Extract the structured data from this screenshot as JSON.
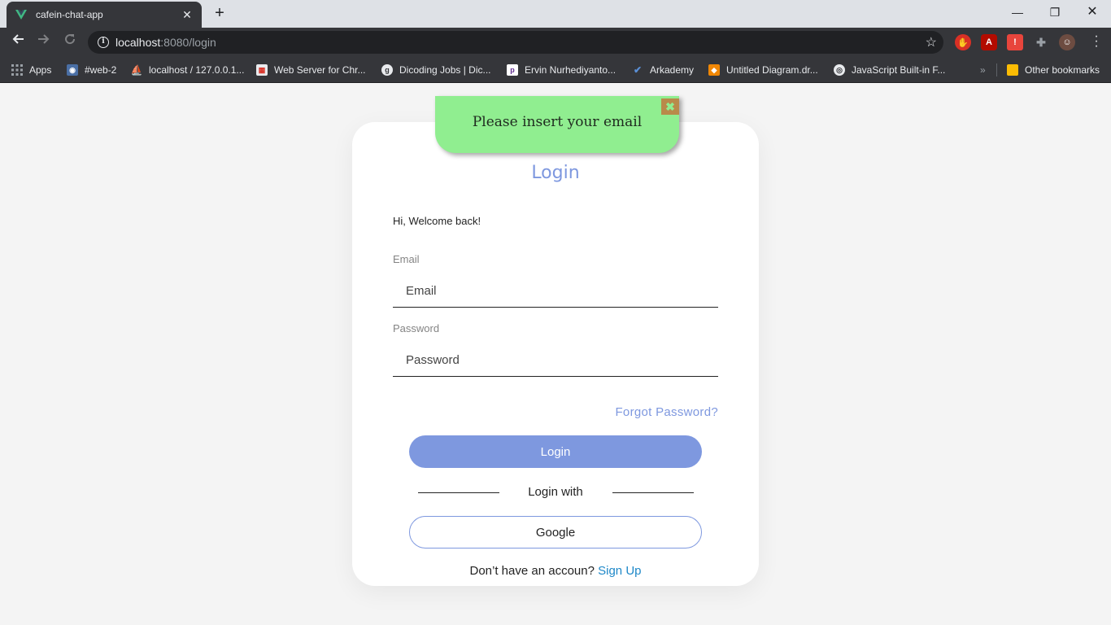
{
  "browser": {
    "tab_title": "cafein-chat-app",
    "tab_close": "✕",
    "new_tab": "+",
    "url_host": "localhost",
    "url_path": ":8080/login",
    "bookmarks": [
      {
        "label": "Apps",
        "icon": "apps-grid-icon"
      },
      {
        "label": "#web-2",
        "icon": "web-icon"
      },
      {
        "label": "localhost / 127.0.0.1...",
        "icon": "phpmyadmin-icon"
      },
      {
        "label": "Web Server for Chr...",
        "icon": "chrome-app-icon"
      },
      {
        "label": "Dicoding Jobs | Dic...",
        "icon": "dicoding-icon"
      },
      {
        "label": "Ervin Nurhediyanto...",
        "icon": "pinterest-icon"
      },
      {
        "label": "Arkademy",
        "icon": "arkademy-icon"
      },
      {
        "label": "Untitled Diagram.dr...",
        "icon": "drawio-icon"
      },
      {
        "label": "JavaScript Built-in F...",
        "icon": "globe-icon"
      }
    ],
    "bookmarks_overflow": "»",
    "other_bookmarks": "Other bookmarks"
  },
  "toast": {
    "message": "Please insert your email",
    "close": "✖"
  },
  "login": {
    "title": "Login",
    "welcome": "Hi, Welcome back!",
    "email_label": "Email",
    "email_placeholder": "Email",
    "password_label": "Password",
    "password_placeholder": "Password",
    "forgot": "Forgot Password?",
    "login_button": "Login",
    "login_with": "Login with",
    "google_button": "Google",
    "signup_prompt": "Don’t have an accoun?",
    "signup_link": "Sign Up"
  },
  "colors": {
    "accent": "#7e98df",
    "toast_bg": "#90ee90",
    "link": "#1e88c8"
  }
}
